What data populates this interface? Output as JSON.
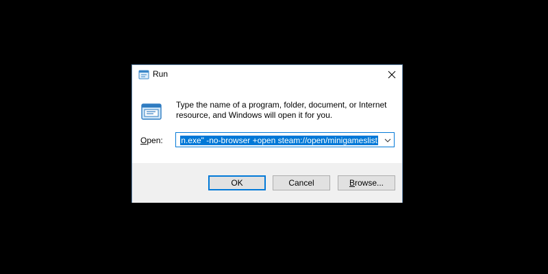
{
  "dialog": {
    "title": "Run",
    "description": "Type the name of a program, folder, document, or Internet resource, and Windows will open it for you.",
    "open_label_mnemonic": "O",
    "open_label_rest": "pen:",
    "open_value": "n.exe\" -no-browser +open steam://open/minigameslist",
    "buttons": {
      "ok": "OK",
      "cancel": "Cancel",
      "browse_mnemonic": "B",
      "browse_rest": "rowse..."
    }
  },
  "icons": {
    "title": "run-app-icon",
    "main": "run-program-icon",
    "close": "close-icon",
    "dropdown": "chevron-down-icon"
  },
  "colors": {
    "background": "#000000",
    "dialog": "#ffffff",
    "footer": "#f0f0f0",
    "accent": "#0078d7",
    "button": "#e1e1e1"
  }
}
